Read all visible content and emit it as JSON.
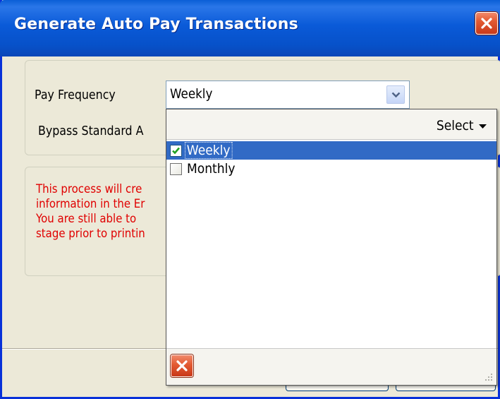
{
  "window": {
    "title": "Generate Auto Pay Transactions",
    "close_icon": "close-icon"
  },
  "form": {
    "pay_frequency_label": "Pay Frequency",
    "pay_frequency_value": "Weekly",
    "bypass_label": "Bypass Standard A"
  },
  "info": {
    "lines": [
      "This process will cre",
      "information in the Er",
      "You are still able to",
      "stage prior to printin"
    ],
    "color": "#e00000"
  },
  "dropdown": {
    "select_label": "Select",
    "items": [
      {
        "label": "Weekly",
        "checked": true,
        "selected": true
      },
      {
        "label": "Monthly",
        "checked": false,
        "selected": false
      }
    ],
    "clear_icon": "clear-icon",
    "grip_icon": "resize-grip-icon"
  },
  "colors": {
    "titlebar": "#0a5ad8",
    "selection": "#316ac5",
    "window_bg": "#ece9d8"
  }
}
